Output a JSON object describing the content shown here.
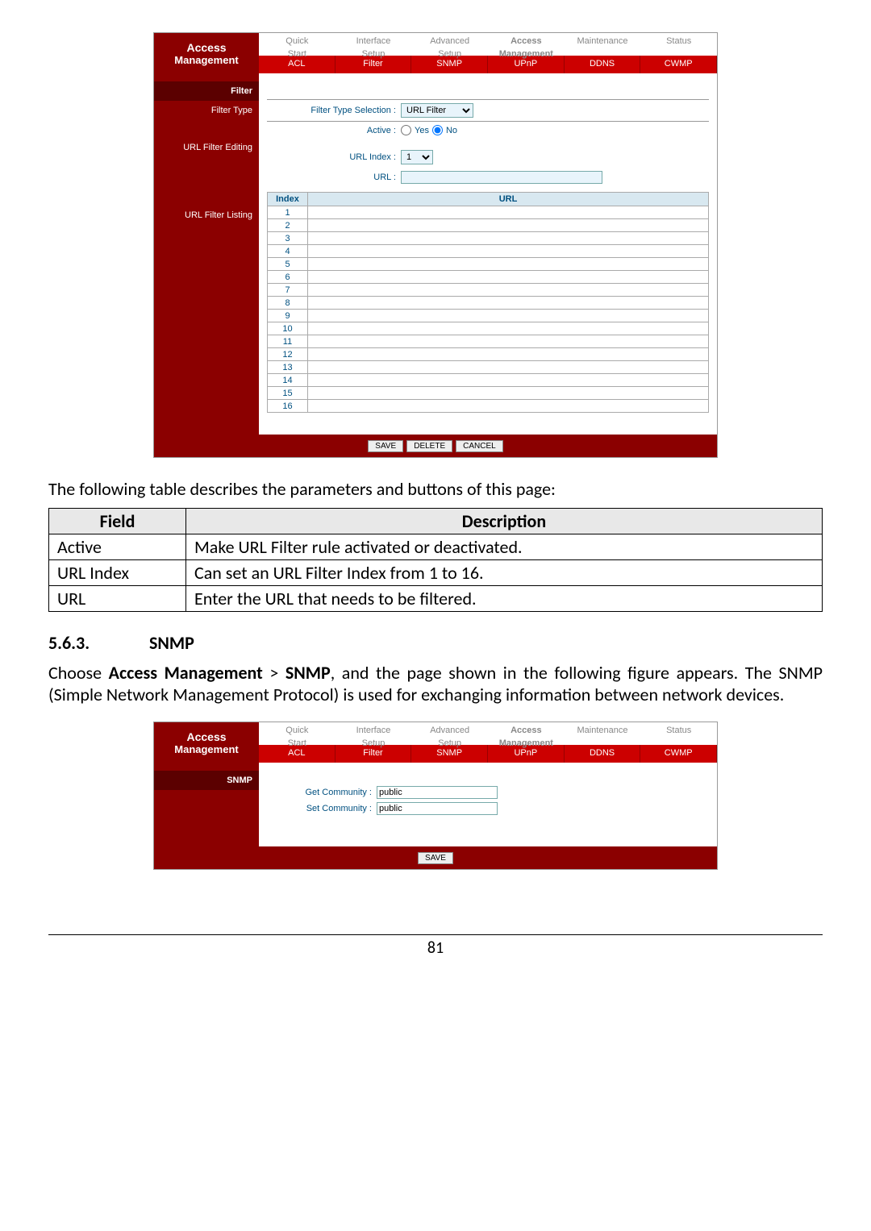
{
  "screenshot1": {
    "side": {
      "line1": "Access",
      "line2": "Management"
    },
    "nav_top": [
      "Quick\nStart",
      "Interface\nSetup",
      "Advanced\nSetup",
      "Access\nManagement",
      "Maintenance",
      "Status"
    ],
    "nav_top_active_index": 3,
    "nav_bot": [
      "ACL",
      "Filter",
      "SNMP",
      "UPnP",
      "DDNS",
      "CWMP"
    ],
    "left_sections": {
      "filter": "Filter",
      "type": "Filter Type",
      "editing": "URL Filter Editing",
      "listing": "URL Filter Listing"
    },
    "filter_type_label": "Filter Type Selection :",
    "filter_type_value": "URL Filter",
    "active_label": "Active :",
    "active_yes": "Yes",
    "active_no": "No",
    "active_selected": "No",
    "url_index_label": "URL Index :",
    "url_index_value": "1",
    "url_label": "URL :",
    "url_value": "",
    "table_headers": {
      "index": "Index",
      "url": "URL"
    },
    "index_rows": [
      1,
      2,
      3,
      4,
      5,
      6,
      7,
      8,
      9,
      10,
      11,
      12,
      13,
      14,
      15,
      16
    ],
    "buttons": {
      "save": "SAVE",
      "delete": "DELETE",
      "cancel": "CANCEL"
    }
  },
  "intro_text": "The following table describes the parameters and buttons of this page:",
  "param_table": {
    "headers": {
      "field": "Field",
      "desc": "Description"
    },
    "rows": [
      {
        "field": "Active",
        "desc": "Make URL Filter rule activated or deactivated."
      },
      {
        "field": "URL Index",
        "desc": "Can set an URL Filter Index from 1 to 16."
      },
      {
        "field": "URL",
        "desc": "Enter the URL that needs to be filtered."
      }
    ]
  },
  "heading": {
    "num": "5.6.3.",
    "title": "SNMP"
  },
  "para": "Choose Access Management > SNMP, and the page shown in the following figure appears. The SNMP (Simple Network Management Protocol) is used for exchanging information between network devices.",
  "screenshot2": {
    "side": {
      "line1": "Access",
      "line2": "Management"
    },
    "nav_top": [
      "Quick\nStart",
      "Interface\nSetup",
      "Advanced\nSetup",
      "Access\nManagement",
      "Maintenance",
      "Status"
    ],
    "nav_top_active_index": 3,
    "nav_bot": [
      "ACL",
      "Filter",
      "SNMP",
      "UPnP",
      "DDNS",
      "CWMP"
    ],
    "snmp_label": "SNMP",
    "get_label": "Get Community :",
    "get_value": "public",
    "set_label": "Set Community :",
    "set_value": "public",
    "save": "SAVE"
  },
  "page_number": "81"
}
